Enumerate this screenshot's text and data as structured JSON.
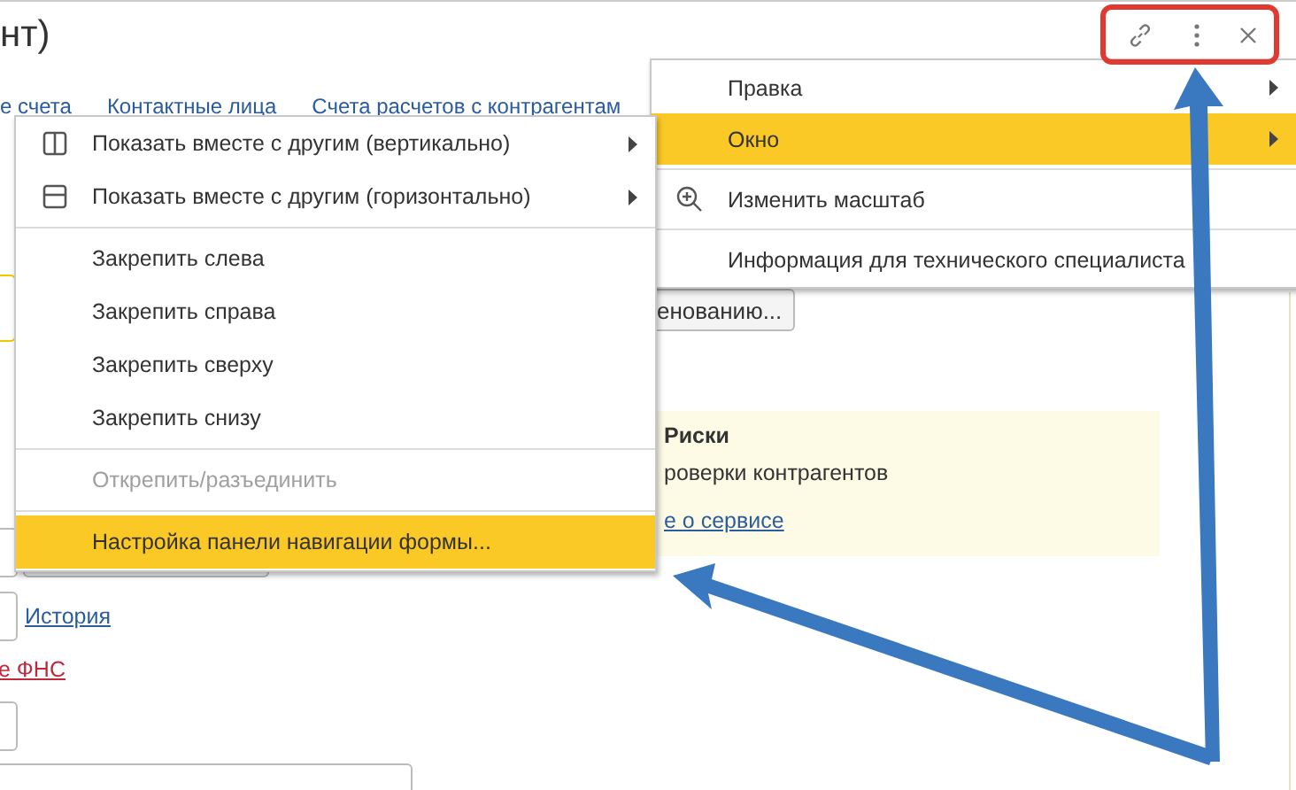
{
  "form": {
    "title": "нт)",
    "tabs": [
      "е счета",
      "Контактные лица",
      "Счета расчетов с контрагентам"
    ],
    "search_button": "енованию...",
    "risk_panel": {
      "heading": "Риски",
      "text": "роверки контрагентов",
      "link": "е о сервисе"
    },
    "history_link": "История",
    "fns_link": "е ФНС"
  },
  "main_menu": [
    {
      "kind": "plain",
      "label": "Правка",
      "has_submenu": true,
      "selected": false
    },
    {
      "kind": "plain",
      "label": "Окно",
      "has_submenu": true,
      "selected": true
    },
    {
      "kind": "separator"
    },
    {
      "kind": "zoom",
      "label": "Изменить масштаб",
      "has_submenu": false,
      "selected": false
    },
    {
      "kind": "separator"
    },
    {
      "kind": "plain",
      "label": "Информация для технического специалиста",
      "has_submenu": false,
      "selected": false
    }
  ],
  "window_menu": [
    {
      "kind": "vertical",
      "label": "Показать вместе с другим (вертикально)",
      "has_submenu": true,
      "disabled": false,
      "selected": false
    },
    {
      "kind": "horizontal",
      "label": "Показать вместе с другим (горизонтально)",
      "has_submenu": true,
      "disabled": false,
      "selected": false
    },
    {
      "kind": "separator"
    },
    {
      "kind": "plain",
      "label": "Закрепить слева",
      "has_submenu": false,
      "disabled": false,
      "selected": false
    },
    {
      "kind": "plain",
      "label": "Закрепить справа",
      "has_submenu": false,
      "disabled": false,
      "selected": false
    },
    {
      "kind": "plain",
      "label": "Закрепить сверху",
      "has_submenu": false,
      "disabled": false,
      "selected": false
    },
    {
      "kind": "plain",
      "label": "Закрепить снизу",
      "has_submenu": false,
      "disabled": false,
      "selected": false
    },
    {
      "kind": "separator"
    },
    {
      "kind": "plain",
      "label": "Открепить/разъединить",
      "has_submenu": false,
      "disabled": true,
      "selected": false
    },
    {
      "kind": "separator"
    },
    {
      "kind": "plain",
      "label": "Настройка панели навигации формы...",
      "has_submenu": false,
      "disabled": false,
      "selected": true
    }
  ]
}
